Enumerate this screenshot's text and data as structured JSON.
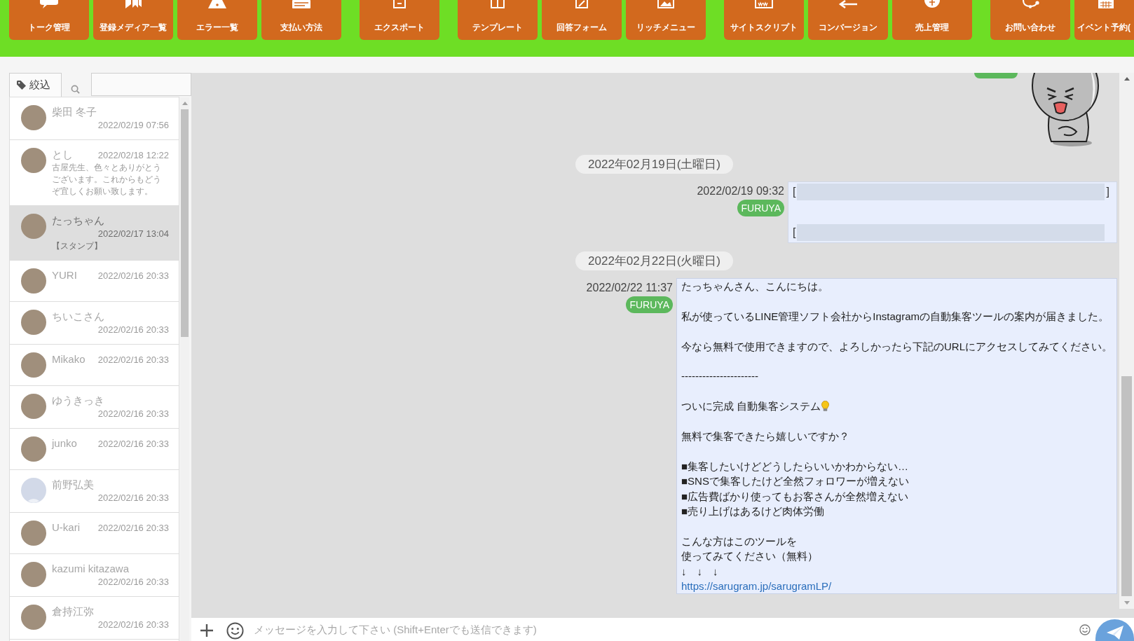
{
  "toolbar": {
    "groups": [
      {
        "buttons": [
          {
            "label": "トーク管理"
          },
          {
            "label": "登録メディア一覧"
          },
          {
            "label": "エラー一覧"
          },
          {
            "label": "支払い方法"
          }
        ]
      },
      {
        "buttons": [
          {
            "label": "エクスポート"
          }
        ]
      },
      {
        "buttons": [
          {
            "label": "テンプレート"
          },
          {
            "label": "回答フォーム"
          },
          {
            "label": "リッチメニュー"
          }
        ]
      },
      {
        "buttons": [
          {
            "label": "サイトスクリプト"
          },
          {
            "label": "コンバージョン"
          },
          {
            "label": "売上管理"
          }
        ]
      },
      {
        "buttons": [
          {
            "label": "お問い合わせ"
          },
          {
            "label": "イベント予約("
          }
        ]
      }
    ]
  },
  "sidebar": {
    "filter_tab": {
      "label": "絞込"
    },
    "contacts": [
      {
        "name": "柴田 冬子",
        "date": "2022/02/19 07:56",
        "avatar": {
          "kind": "photo"
        },
        "selected": false
      },
      {
        "name": "とし",
        "date": "2022/02/18 12:22",
        "preview": "古屋先生、色々とありがとうございます。これからもどうぞ宜しくお願い致します。",
        "avatar": {
          "kind": "photo"
        },
        "selected": false
      },
      {
        "name": "たっちゃん",
        "date": "2022/02/17 13:04",
        "preview": "【スタンプ】",
        "avatar": {
          "kind": "photo"
        },
        "selected": true
      },
      {
        "name": "YURI",
        "date": "2022/02/16 20:33",
        "avatar": {
          "kind": "photo"
        },
        "selected": false
      },
      {
        "name": "ちいこさん",
        "date": "2022/02/16 20:33",
        "avatar": {
          "kind": "photo"
        },
        "selected": false
      },
      {
        "name": "Mikako",
        "date": "2022/02/16 20:33",
        "avatar": {
          "kind": "photo"
        },
        "selected": false
      },
      {
        "name": "ゆうきっき",
        "date": "2022/02/16 20:33",
        "avatar": {
          "kind": "photo"
        },
        "selected": false
      },
      {
        "name": "junko",
        "date": "2022/02/16 20:33",
        "avatar": {
          "kind": "photo"
        },
        "selected": false
      },
      {
        "name": "前野弘美",
        "date": "2022/02/16 20:33",
        "avatar": {
          "kind": "silhouette"
        },
        "selected": false
      },
      {
        "name": "U-kari",
        "date": "2022/02/16 20:33",
        "avatar": {
          "kind": "photo"
        },
        "selected": false
      },
      {
        "name": "kazumi kitazawa",
        "date": "2022/02/16 20:33",
        "avatar": {
          "kind": "photo"
        },
        "selected": false
      },
      {
        "name": "倉持江弥",
        "date": "2022/02/16 20:33",
        "avatar": {
          "kind": "photo"
        },
        "selected": false
      }
    ]
  },
  "chat": {
    "timeline": [
      {
        "kind": "sticker"
      },
      {
        "kind": "date",
        "text": "2022年02月19日(土曜日)"
      },
      {
        "kind": "redacted",
        "time": "2022/02/19 09:32",
        "sender": "FURUYA",
        "lines": [
          {
            "start": "[",
            "end": "]"
          },
          {
            "start": "["
          }
        ]
      },
      {
        "kind": "date",
        "text": "2022年02月22日(火曜日)"
      },
      {
        "kind": "text",
        "time": "2022/02/22 11:37",
        "sender": "FURUYA",
        "paragraphs": [
          {
            "lines": [
              {
                "kind": "text",
                "text": "たっちゃんさん、こんにちは。"
              }
            ]
          },
          {
            "lines": [
              {
                "kind": "text",
                "text": "私が使っているLINE管理ソフト会社からInstagramの自動集客ツールの案内が届きました。"
              }
            ]
          },
          {
            "lines": [
              {
                "kind": "text",
                "text": "今なら無料で使用できますので、よろしかったら下記のURLにアクセスしてみてください。"
              }
            ]
          },
          {
            "lines": [
              {
                "kind": "text",
                "text": "----------------------"
              }
            ]
          },
          {
            "lines": [
              {
                "kind": "bulb",
                "text": "ついに完成 自動集客システム"
              }
            ]
          },
          {
            "lines": [
              {
                "kind": "text",
                "text": "無料で集客できたら嬉しいですか？"
              }
            ]
          },
          {
            "lines": [
              {
                "kind": "text",
                "text": "■集客したいけどどうしたらいいかわからない…"
              },
              {
                "kind": "text",
                "text": "■SNSで集客したけど全然フォロワーが増えない"
              },
              {
                "kind": "text",
                "text": "■広告費ばかり使ってもお客さんが全然増えない"
              },
              {
                "kind": "text",
                "text": "■売り上げはあるけど肉体労働"
              }
            ]
          },
          {
            "lines": [
              {
                "kind": "text",
                "text": "こんな方はこのツールを"
              },
              {
                "kind": "text",
                "text": "使ってみてください（無料）"
              },
              {
                "kind": "text",
                "text": "↓　↓　↓"
              },
              {
                "kind": "link",
                "text": "https://sarugram.jp/sarugramLP/"
              }
            ]
          }
        ]
      }
    ],
    "input": {
      "placeholder": "メッセージを入力して下さい (Shift+Enterでも送信できます)"
    }
  }
}
